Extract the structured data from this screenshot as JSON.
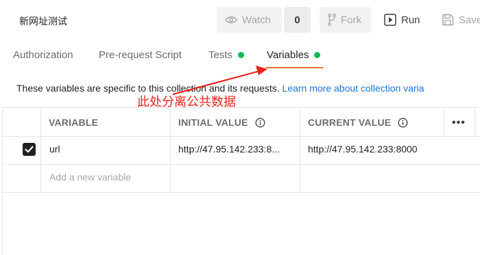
{
  "header": {
    "collection_name": "新网址测试",
    "watch_label": "Watch",
    "watch_count": "0",
    "fork_label": "Fork",
    "run_label": "Run",
    "save_label": "Save"
  },
  "tabs": [
    {
      "label": "Authorization",
      "has_dot": false
    },
    {
      "label": "Pre-request Script",
      "has_dot": false
    },
    {
      "label": "Tests",
      "has_dot": true
    },
    {
      "label": "Variables",
      "has_dot": true,
      "active": true
    }
  ],
  "description": {
    "text": "These variables are specific to this collection and its requests.",
    "link": "Learn more about collection varia"
  },
  "annotation": {
    "text": "此处分离公共数据",
    "color": "#e8241b"
  },
  "table": {
    "headers": {
      "variable": "VARIABLE",
      "initial": "INITIAL VALUE",
      "current": "CURRENT VALUE"
    },
    "rows": [
      {
        "checked": true,
        "variable": "url",
        "initial": "http://47.95.142.233:8...",
        "current": "http://47.95.142.233:8000"
      }
    ],
    "new_placeholder": "Add a new variable"
  },
  "colors": {
    "accent": "#ff6c37",
    "dot": "#0cbb52",
    "link": "#1a73d6"
  }
}
